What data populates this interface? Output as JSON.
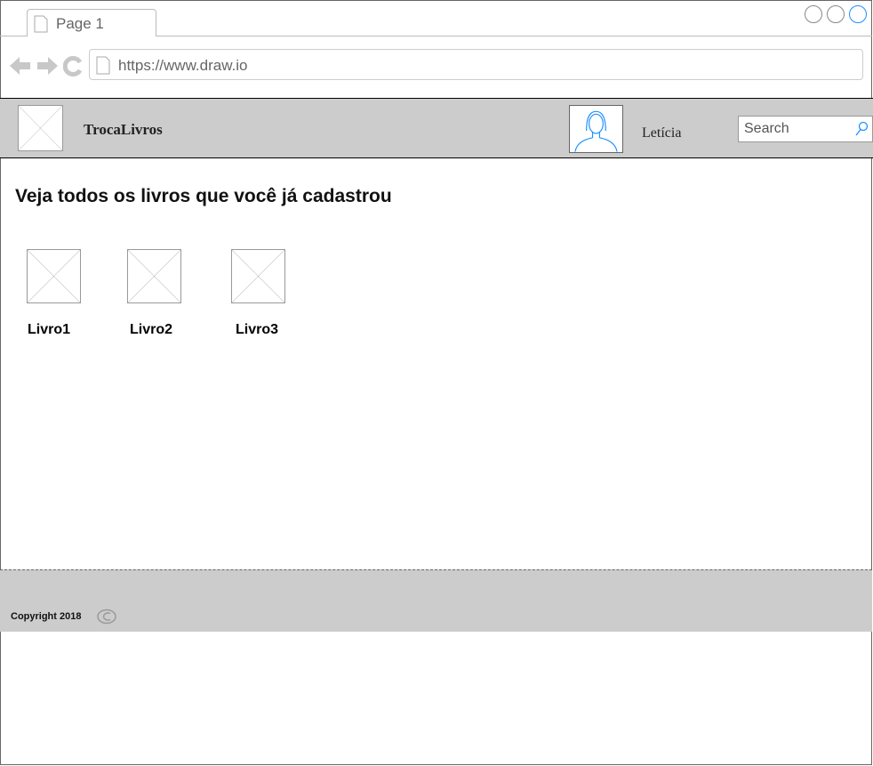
{
  "browser": {
    "tab_label": "Page 1",
    "url": "https://www.draw.io"
  },
  "navbar": {
    "brand": "TrocaLivros",
    "user_name": "Letícia",
    "search_placeholder": "Search"
  },
  "main": {
    "heading": "Veja todos os livros que você já cadastrou",
    "books": [
      {
        "label": "Livro1"
      },
      {
        "label": "Livro2"
      },
      {
        "label": "Livro3"
      }
    ]
  },
  "footer": {
    "copyright": "Copyright 2018"
  },
  "colors": {
    "accent": "#1e90ff",
    "navbar_bg": "#cccccc"
  }
}
